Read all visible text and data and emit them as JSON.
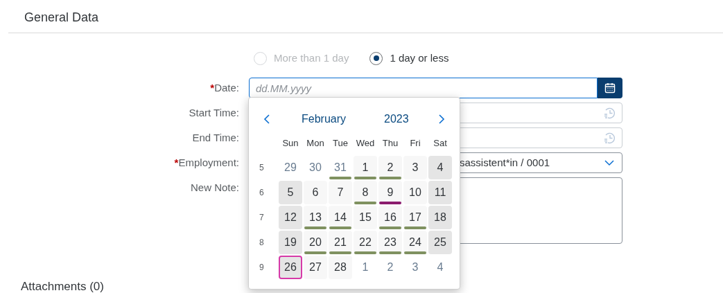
{
  "section_title": "General Data",
  "duration_options": [
    {
      "label": "More than 1 day",
      "selected": false,
      "disabled": true
    },
    {
      "label": "1 day or less",
      "selected": true,
      "disabled": false
    }
  ],
  "fields": [
    {
      "label": "Date:",
      "required_mark": "*",
      "kind": "date",
      "placeholder": "dd.MM.yyyy"
    },
    {
      "label": "Start Time:",
      "kind": "time"
    },
    {
      "label": "End Time:",
      "kind": "time"
    },
    {
      "label": "Employment:",
      "required_mark": "*",
      "kind": "select",
      "value": "sassistent*in / 0001"
    },
    {
      "label": "New Note:",
      "kind": "textarea"
    }
  ],
  "calendar": {
    "month": "February",
    "year": "2023",
    "weekdays": [
      "Sun",
      "Mon",
      "Tue",
      "Wed",
      "Thu",
      "Fri",
      "Sat"
    ],
    "weeks": [
      {
        "number": "5",
        "days": [
          {
            "day": "29",
            "kind": "other",
            "today": false
          },
          {
            "day": "30",
            "kind": "other",
            "today": false
          },
          {
            "day": "31",
            "kind": "other",
            "today": false,
            "color": "#7f9160"
          },
          {
            "day": "1",
            "kind": "weekday",
            "today": false,
            "color": "#7f9160"
          },
          {
            "day": "2",
            "kind": "weekday",
            "today": false,
            "color": "#7f9160"
          },
          {
            "day": "3",
            "kind": "weekday",
            "today": false
          },
          {
            "day": "4",
            "kind": "weekend",
            "today": false
          }
        ]
      },
      {
        "number": "6",
        "days": [
          {
            "day": "5",
            "kind": "weekend",
            "today": false
          },
          {
            "day": "6",
            "kind": "weekday",
            "today": false
          },
          {
            "day": "7",
            "kind": "weekday",
            "today": false
          },
          {
            "day": "8",
            "kind": "weekday",
            "today": false,
            "color": "#7f9160"
          },
          {
            "day": "9",
            "kind": "weekday",
            "today": false,
            "color": "#8b1c6e"
          },
          {
            "day": "10",
            "kind": "weekday",
            "today": false
          },
          {
            "day": "11",
            "kind": "weekend",
            "today": false
          }
        ]
      },
      {
        "number": "7",
        "days": [
          {
            "day": "12",
            "kind": "weekend",
            "today": false
          },
          {
            "day": "13",
            "kind": "weekday",
            "today": false,
            "color": "#7f9160"
          },
          {
            "day": "14",
            "kind": "weekday",
            "today": false,
            "color": "#7f9160"
          },
          {
            "day": "15",
            "kind": "weekday",
            "today": false
          },
          {
            "day": "16",
            "kind": "weekday",
            "today": false,
            "color": "#7f9160"
          },
          {
            "day": "17",
            "kind": "weekday",
            "today": false,
            "color": "#7f9160"
          },
          {
            "day": "18",
            "kind": "weekend",
            "today": false
          }
        ]
      },
      {
        "number": "8",
        "days": [
          {
            "day": "19",
            "kind": "weekend",
            "today": false
          },
          {
            "day": "20",
            "kind": "weekday",
            "today": false,
            "color": "#7f9160"
          },
          {
            "day": "21",
            "kind": "weekday",
            "today": false,
            "color": "#7f9160"
          },
          {
            "day": "22",
            "kind": "weekday",
            "today": false,
            "color": "#7f9160"
          },
          {
            "day": "23",
            "kind": "weekday",
            "today": false,
            "color": "#7f9160"
          },
          {
            "day": "24",
            "kind": "weekday",
            "today": false,
            "color": "#7f9160"
          },
          {
            "day": "25",
            "kind": "weekend",
            "today": false
          }
        ]
      },
      {
        "number": "9",
        "days": [
          {
            "day": "26",
            "kind": "weekend",
            "today": true
          },
          {
            "day": "27",
            "kind": "weekday",
            "today": false
          },
          {
            "day": "28",
            "kind": "weekday",
            "today": false
          },
          {
            "day": "1",
            "kind": "other",
            "today": false
          },
          {
            "day": "2",
            "kind": "other",
            "today": false
          },
          {
            "day": "3",
            "kind": "other",
            "today": false
          },
          {
            "day": "4",
            "kind": "other",
            "today": false
          }
        ]
      }
    ]
  },
  "attachments_title": "Attachments (0)"
}
